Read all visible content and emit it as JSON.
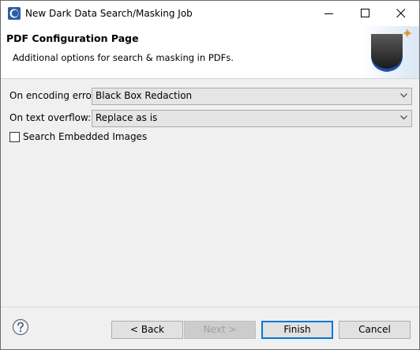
{
  "window": {
    "title": "New Dark Data Search/Masking Job",
    "app_icon": "eclipse-logo-icon"
  },
  "banner": {
    "title": "PDF Configuration Page",
    "description": "Additional options for search & masking in PDFs.",
    "image": "wizard-banner-graphic"
  },
  "form": {
    "encoding_error": {
      "label": "On encoding error:",
      "value": "Black Box Redaction"
    },
    "text_overflow": {
      "label": "On text overflow:",
      "value": "Replace as is"
    },
    "embedded_images": {
      "label": "Search Embedded Images",
      "checked": false
    }
  },
  "footer": {
    "help_icon": "help-icon",
    "back_label": "< Back",
    "next_label": "Next >",
    "finish_label": "Finish",
    "cancel_label": "Cancel"
  },
  "colors": {
    "accent": "#0078d7",
    "window_bg": "#f0f0f0",
    "banner_bg": "#ffffff"
  }
}
